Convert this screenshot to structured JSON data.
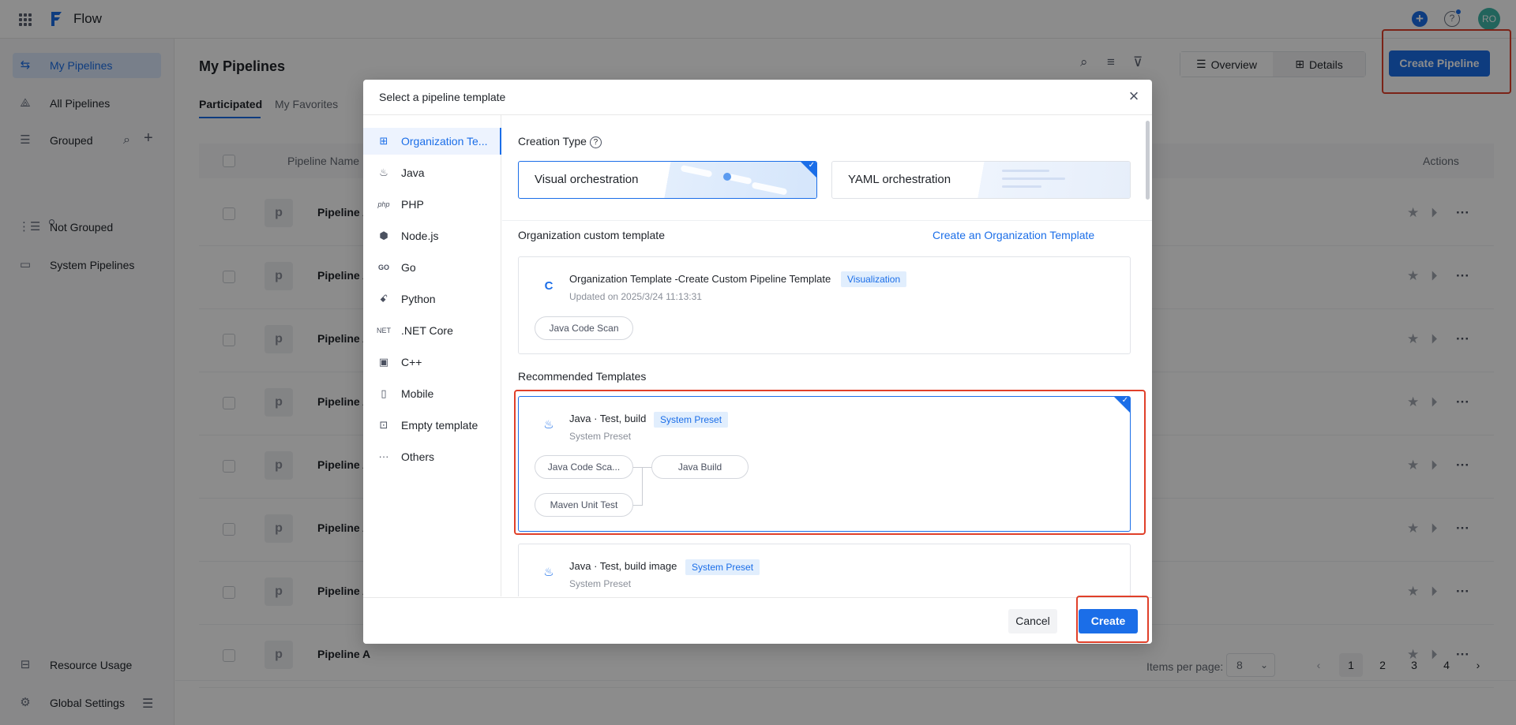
{
  "app": {
    "title": "Flow",
    "avatar_initials": "RO",
    "brand_color": "#1b6ee8"
  },
  "sidebar": {
    "items": [
      {
        "label": "My Pipelines",
        "icon": "pipeline-icon",
        "active": true
      },
      {
        "label": "All Pipelines",
        "icon": "nodes-icon"
      },
      {
        "label": "Grouped",
        "icon": "list-tree-icon"
      },
      {
        "label": "Not Grouped",
        "icon": "ungrouped-icon"
      },
      {
        "label": "System Pipelines",
        "icon": "monitor-icon"
      }
    ],
    "group_item": "o",
    "bottom": [
      {
        "label": "Resource Usage",
        "icon": "inbox-icon"
      },
      {
        "label": "Global Settings",
        "icon": "gear-icon"
      }
    ]
  },
  "main": {
    "title": "My Pipelines",
    "tabs": [
      "Participated",
      "My Favorites"
    ],
    "view": {
      "overview": "Overview",
      "details": "Details"
    },
    "create_button": "Create Pipeline",
    "columns": {
      "name": "Pipeline Name",
      "actions": "Actions"
    },
    "rows": [
      {
        "avatar": "p",
        "name": "Pipeline A"
      },
      {
        "avatar": "p",
        "name": "Pipeline A"
      },
      {
        "avatar": "p",
        "name": "Pipeline A"
      },
      {
        "avatar": "p",
        "name": "Pipeline A"
      },
      {
        "avatar": "p",
        "name": "Pipeline A"
      },
      {
        "avatar": "p",
        "name": "Pipeline A"
      },
      {
        "avatar": "p",
        "name": "Pipeline A"
      },
      {
        "avatar": "p",
        "name": "Pipeline A"
      }
    ],
    "pagination": {
      "items_per_page_label": "Items per page:",
      "per_page": "8",
      "pages": [
        "1",
        "2",
        "3",
        "4"
      ],
      "current": "1"
    }
  },
  "modal": {
    "title": "Select a pipeline template",
    "categories": [
      {
        "label": "Organization Te...",
        "icon": "grid-icon"
      },
      {
        "label": "Java",
        "icon": "java-icon"
      },
      {
        "label": "PHP",
        "icon": "php-icon",
        "icon_text": "php"
      },
      {
        "label": "Node.js",
        "icon": "nodejs-icon"
      },
      {
        "label": "Go",
        "icon": "go-icon",
        "icon_text": "GO"
      },
      {
        "label": "Python",
        "icon": "python-icon"
      },
      {
        "label": ".NET Core",
        "icon": "dotnet-icon",
        "icon_text": "NET"
      },
      {
        "label": "C++",
        "icon": "cpp-icon"
      },
      {
        "label": "Mobile",
        "icon": "mobile-icon"
      },
      {
        "label": "Empty template",
        "icon": "empty-template-icon"
      },
      {
        "label": "Others",
        "icon": "more-icon"
      }
    ],
    "creation_type": {
      "label": "Creation Type",
      "options": [
        "Visual orchestration",
        "YAML orchestration"
      ],
      "selected": "Visual orchestration"
    },
    "org_section": {
      "label": "Organization custom template",
      "link": "Create an Organization Template",
      "card": {
        "icon_letter": "C",
        "title": "Organization Template -Create Custom Pipeline Template",
        "badge": "Visualization",
        "updated": "Updated on 2025/3/24 11:13:31",
        "steps": [
          "Java Code Scan"
        ]
      }
    },
    "recommended": {
      "label": "Recommended Templates",
      "cards": [
        {
          "title": "Java · Test, build",
          "badge": "System Preset",
          "sub": "System Preset",
          "steps": [
            "Java Code Sca...",
            "Java Build",
            "Maven Unit Test"
          ]
        },
        {
          "title": "Java · Test, build image",
          "badge": "System Preset",
          "sub": "System Preset"
        }
      ]
    },
    "footer": {
      "cancel": "Cancel",
      "create": "Create"
    }
  },
  "highlight_color": "#e0402a"
}
